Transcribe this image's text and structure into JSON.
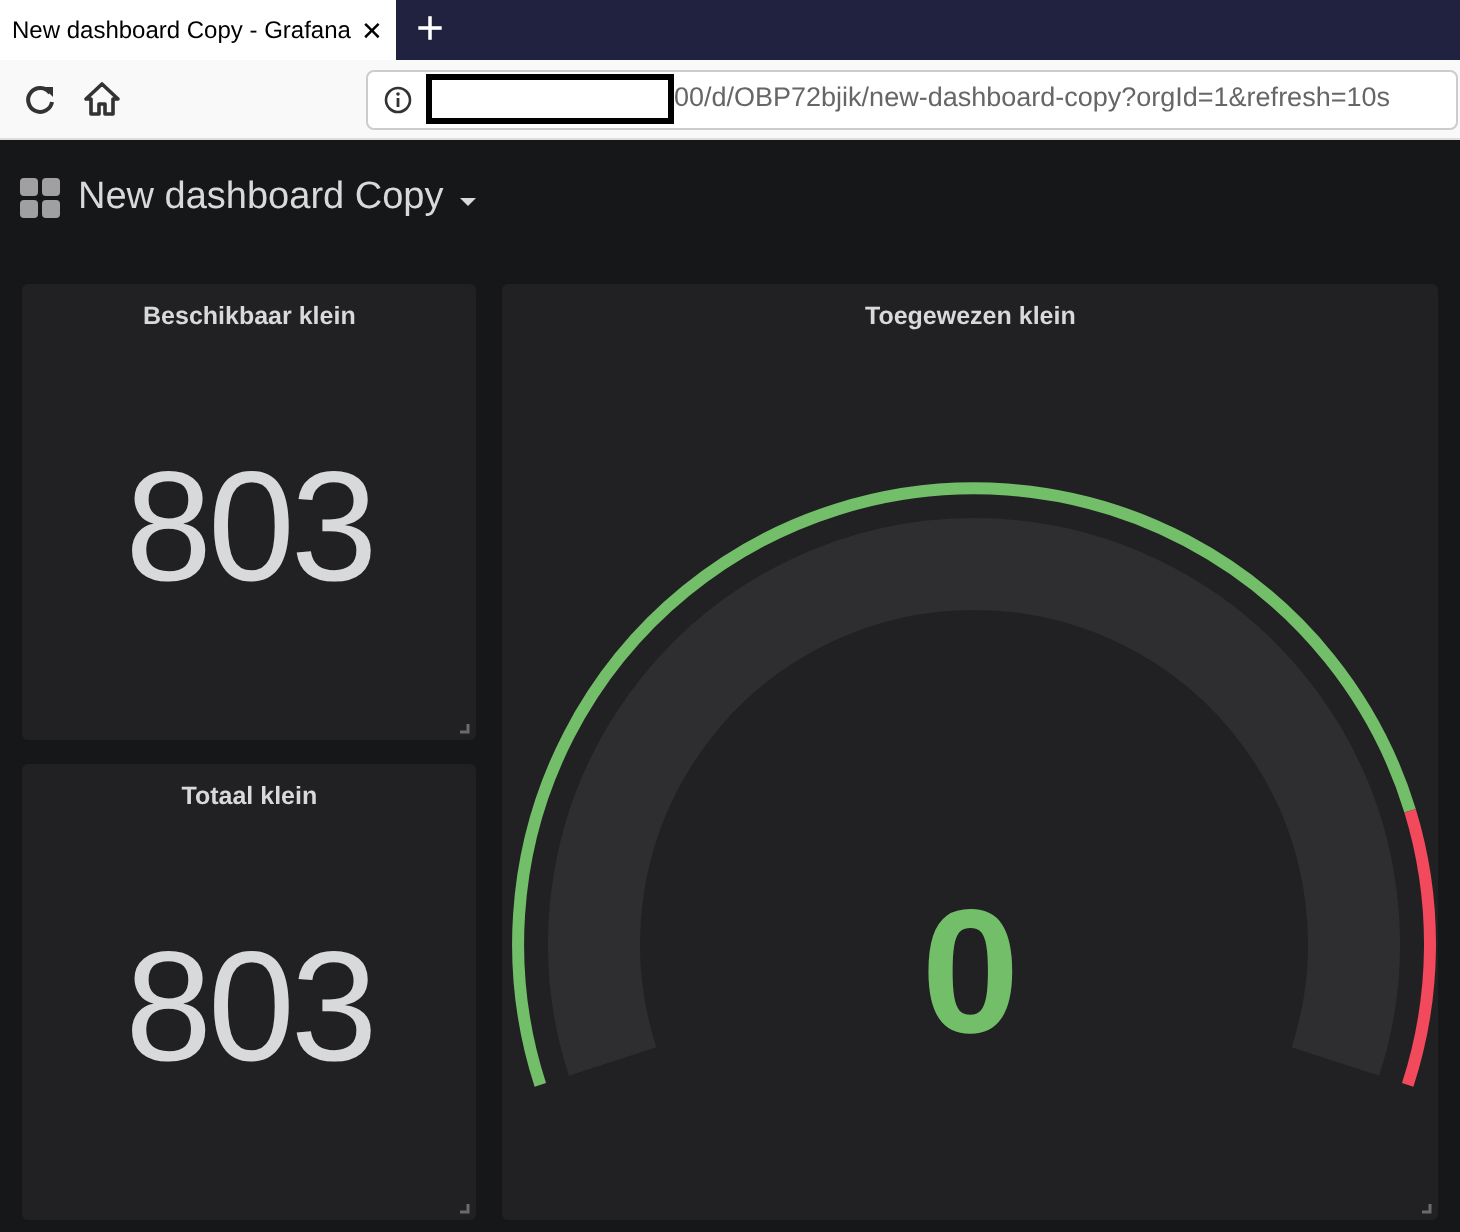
{
  "browser": {
    "tab": {
      "title": "New dashboard Copy - Grafana",
      "close": "✕"
    },
    "new_tab": "+",
    "url": "00/d/OBP72bjik/new-dashboard-copy?orgId=1&refresh=10s"
  },
  "dashboard": {
    "title": "New dashboard Copy"
  },
  "panels": [
    {
      "kind": "stat",
      "title": "Beschikbaar klein",
      "value": "803"
    },
    {
      "kind": "stat",
      "title": "Totaal klein",
      "value": "803"
    },
    {
      "kind": "gauge",
      "title": "Toegewezen klein",
      "value": "0"
    }
  ]
}
